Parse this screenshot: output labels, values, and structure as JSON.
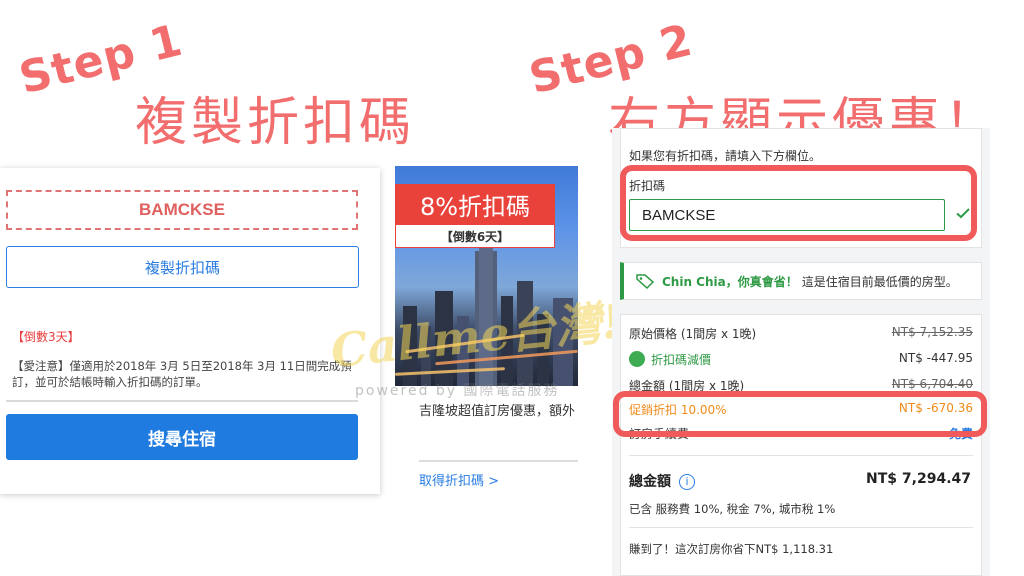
{
  "steps": {
    "step1_label": "Step 1",
    "step1_title": "複製折扣碼",
    "step2_label": "Step 2",
    "step2_title": "右方顯示優惠！"
  },
  "coupon_card": {
    "code": "BAMCKSE",
    "copy_button": "複製折扣碼",
    "countdown": "【倒數3天】",
    "note": "【愛注意】僅適用於2018年 3月 5日至2018年 3月 11日間完成預訂，並可於結帳時輸入折扣碼的訂單。",
    "search_button": "搜尋住宿"
  },
  "promo_card": {
    "banner": "8%折扣碼",
    "countdown": "【倒數6天】",
    "description": "吉隆坡超值訂房優惠，額外",
    "get_code_link": "取得折扣碼 >"
  },
  "watermark": {
    "logo": "Callme台灣!",
    "powered": "powered by 國際電話服務"
  },
  "booking": {
    "discount_hint": "如果您有折扣碼，請填入下方欄位。",
    "discount_label": "折扣碼",
    "discount_value": "BAMCKSE",
    "notice_name": "Chin Chia，你真會省！",
    "notice_text": "這是住宿目前最低價的房型。",
    "original_label": "原始價格 (1間房 x 1晚)",
    "original_value": "NT$ 7,152.35",
    "coupon_label": "折扣碼減價",
    "coupon_value": "NT$ -447.95",
    "subtotal_label": "總金額 (1間房 x 1晚)",
    "subtotal_value": "NT$ 6,704.40",
    "promo_label": "促銷折扣 10.00%",
    "promo_value": "NT$ -670.36",
    "room_tax_label": "訂房手續費",
    "room_tax_value": "免費",
    "total_label": "總金額",
    "total_value": "NT$ 7,294.47",
    "tax_note": "已含 服務費 10%, 稅金 7%, 城市稅 1%",
    "saved_note": "賺到了！這次訂房你省下NT$ 1,118.31"
  },
  "colors": {
    "accent_red": "#f26d6d",
    "highlight_red": "#f05a5a",
    "primary_blue": "#1f7be0",
    "success_green": "#2f9a45",
    "promo_orange": "#f08b1a"
  }
}
